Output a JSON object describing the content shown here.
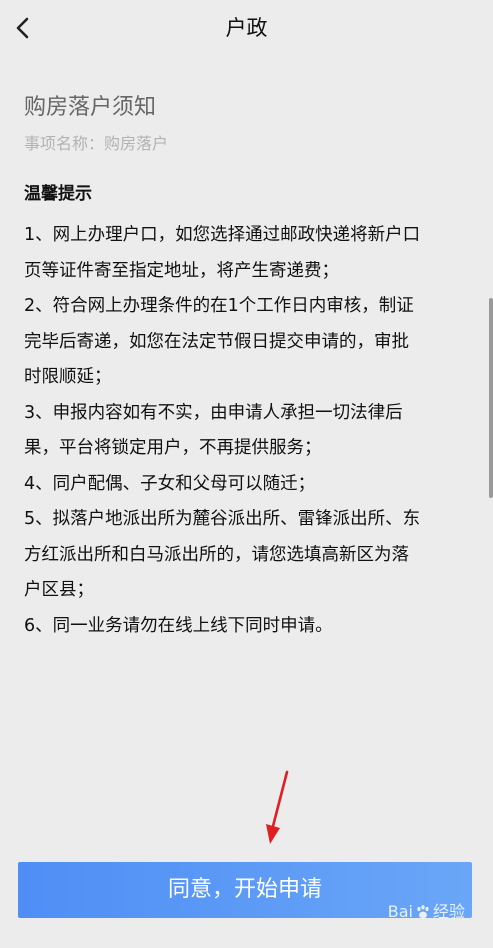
{
  "header": {
    "title": "户政"
  },
  "notice": {
    "title": "购房落户须知",
    "item_name_label": "事项名称：",
    "item_name_value": "购房落户"
  },
  "tips": {
    "heading": "温馨提示",
    "lines": [
      "1、网上办理户口，如您选择通过邮政快递将新户口",
      "页等证件寄至指定地址，将产生寄递费；",
      "2、符合网上办理条件的在1个工作日内审核，制证",
      "完毕后寄递，如您在法定节假日提交申请的，审批",
      "时限顺延；",
      "3、申报内容如有不实，由申请人承担一切法律后",
      "果，平台将锁定用户，不再提供服务；",
      "4、同户配偶、子女和父母可以随迁；",
      "5、拟落户地派出所为麓谷派出所、雷锋派出所、东",
      "方红派出所和白马派出所的，请您选填高新区为落",
      "户区县；",
      "6、同一业务请勿在线上线下同时申请。"
    ]
  },
  "footer": {
    "agree_label": "同意，开始申请"
  },
  "watermark": {
    "brand_left": "Bai",
    "brand_right": "经验"
  },
  "colors": {
    "background": "#ececec",
    "button_start": "#4f8ef6",
    "button_end": "#6aa6f7",
    "annotation_arrow": "#e02020"
  },
  "icons": {
    "back": "chevron-left-icon",
    "arrow": "annotation-arrow-icon",
    "paw": "baidu-paw-icon"
  }
}
